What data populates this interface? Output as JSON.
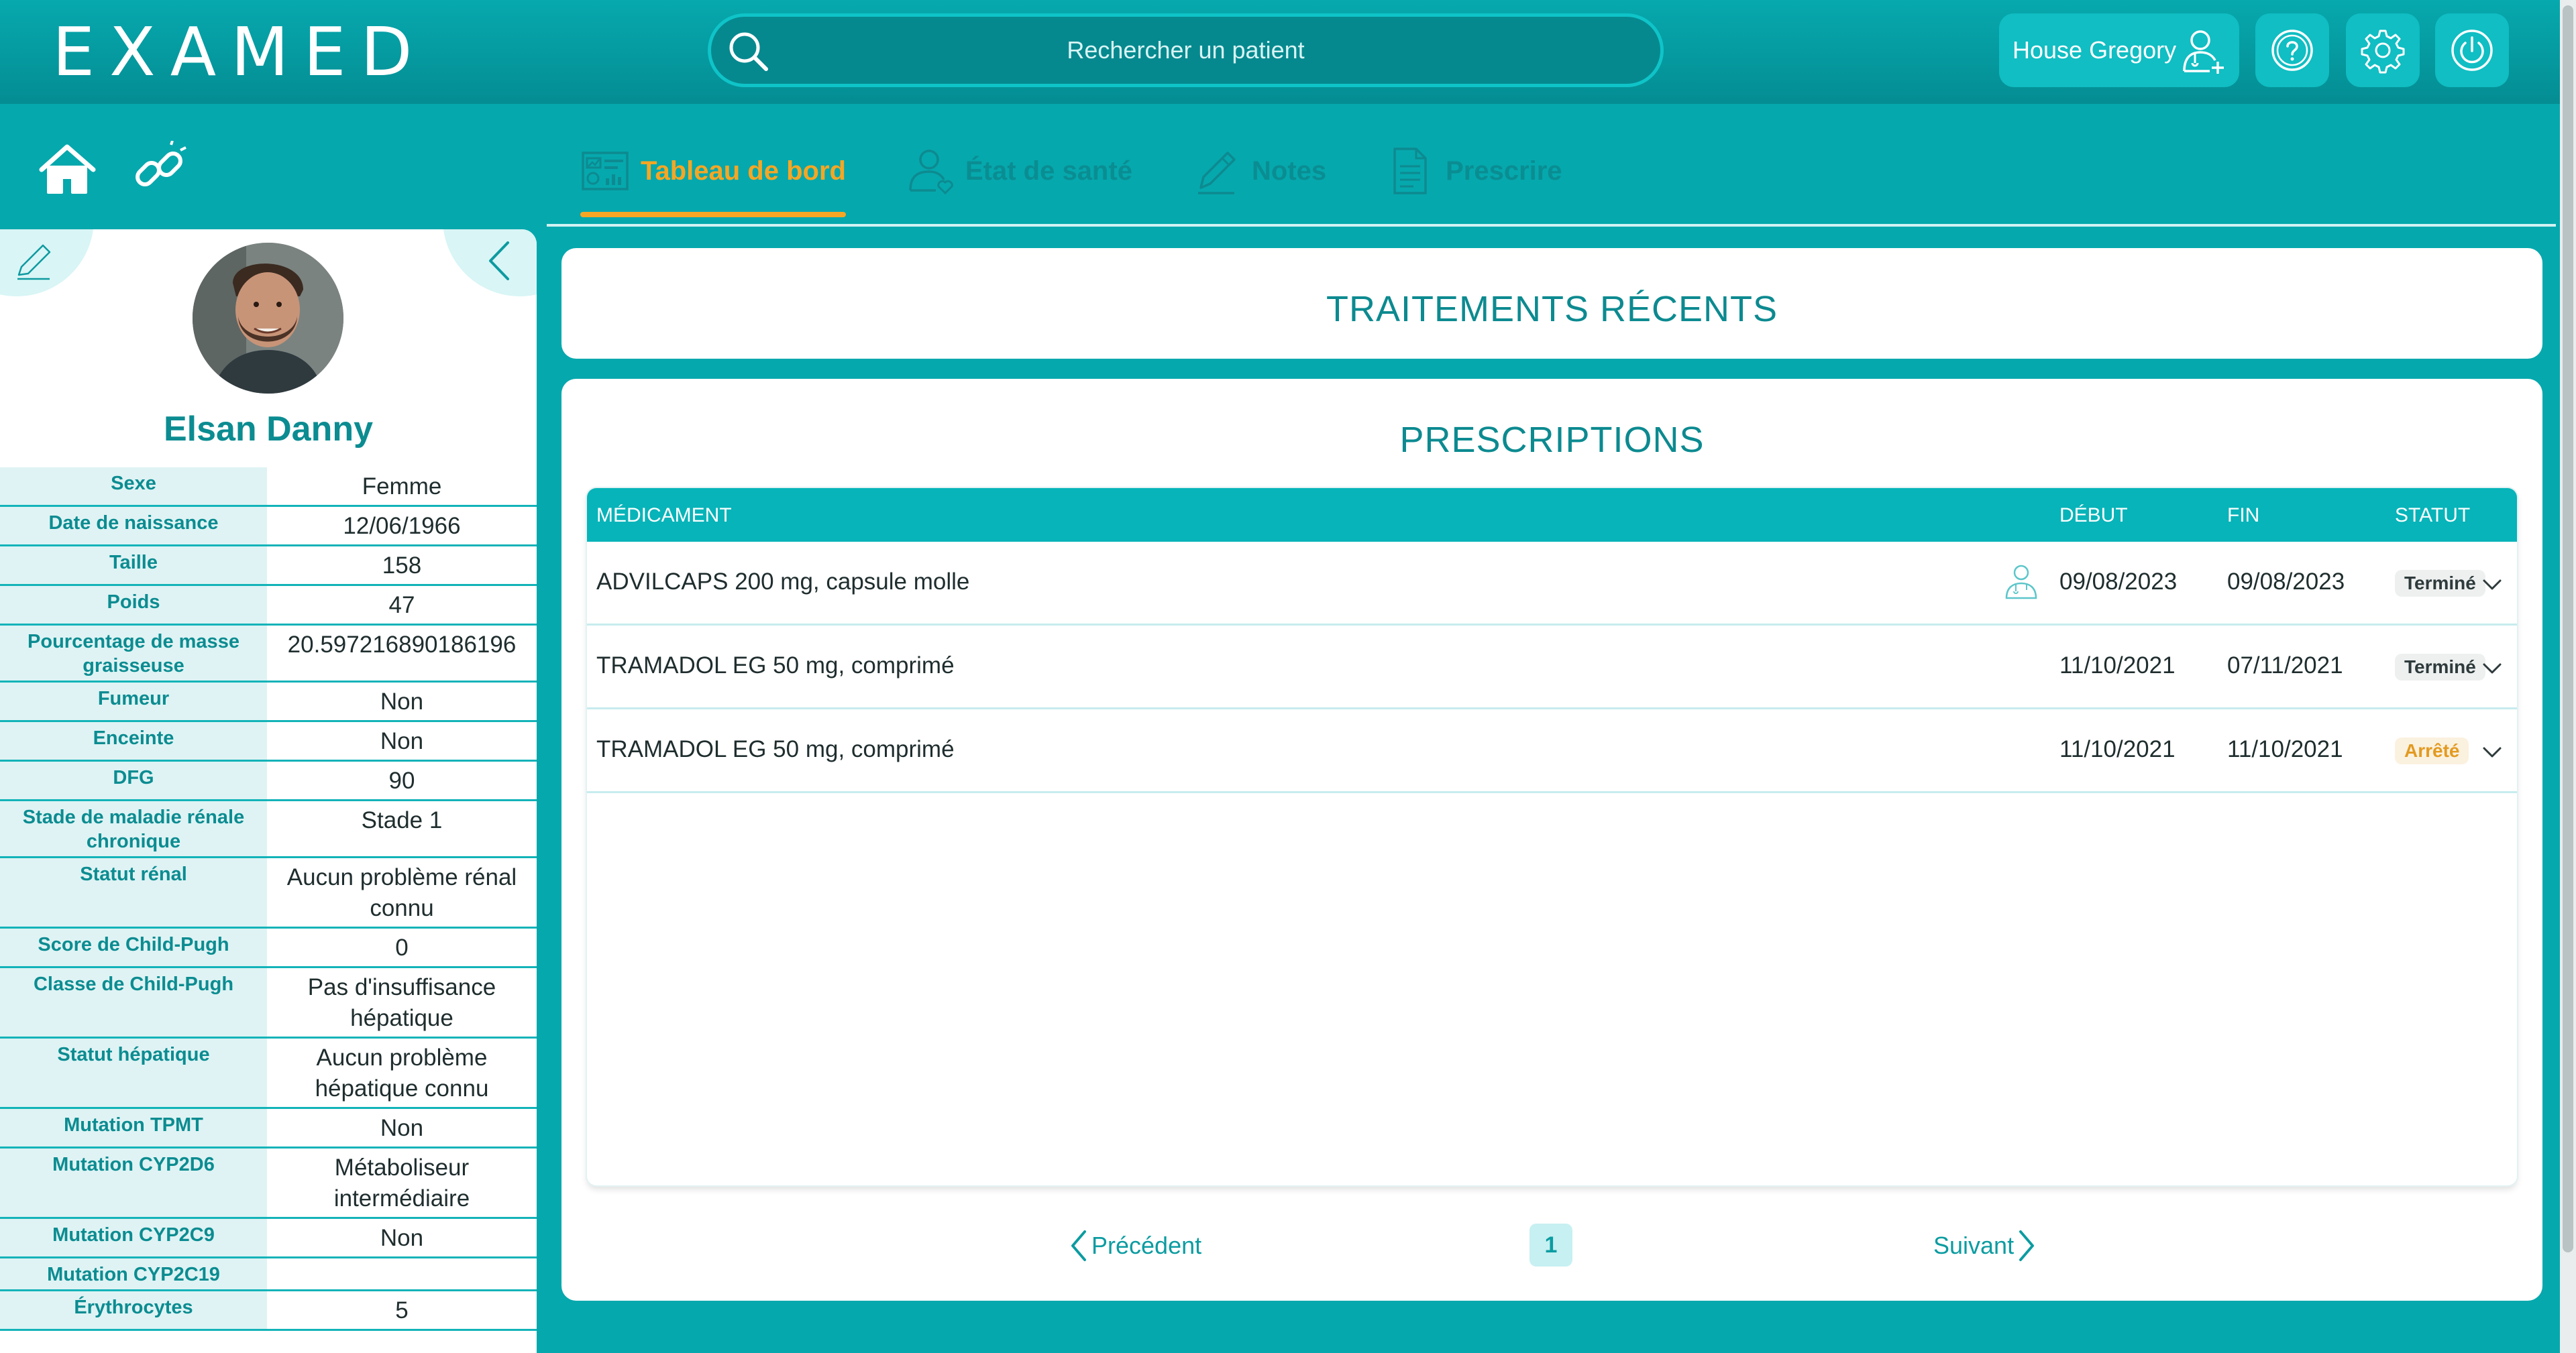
{
  "header": {
    "logo_text": "EXAMED",
    "search_placeholder": "Rechercher un patient",
    "user_name": "House Gregory",
    "icons": [
      "search-icon",
      "doctor-add-icon",
      "help-icon",
      "gear-icon",
      "power-icon"
    ]
  },
  "nav": {
    "icons": [
      "home-icon",
      "link-icon"
    ],
    "tabs": [
      {
        "label": "Tableau de bord",
        "icon": "dashboard-icon",
        "active": true
      },
      {
        "label": "État de santé",
        "icon": "health-icon",
        "active": false
      },
      {
        "label": "Notes",
        "icon": "pencil-icon",
        "active": false
      },
      {
        "label": "Prescrire",
        "icon": "document-icon",
        "active": false
      }
    ],
    "active_color": "#f6a623"
  },
  "patient": {
    "name": "Elsan Danny",
    "fields": [
      {
        "label": "Sexe",
        "value": "Femme"
      },
      {
        "label": "Date de naissance",
        "value": "12/06/1966"
      },
      {
        "label": "Taille",
        "value": "158"
      },
      {
        "label": "Poids",
        "value": "47"
      },
      {
        "label": "Pourcentage de masse graisseuse",
        "value": "20.597216890186196"
      },
      {
        "label": "Fumeur",
        "value": "Non"
      },
      {
        "label": "Enceinte",
        "value": "Non"
      },
      {
        "label": "DFG",
        "value": "90"
      },
      {
        "label": "Stade de maladie rénale chronique",
        "value": "Stade 1"
      },
      {
        "label": "Statut rénal",
        "value": "Aucun problème rénal connu"
      },
      {
        "label": "Score de Child-Pugh",
        "value": "0"
      },
      {
        "label": "Classe de Child-Pugh",
        "value": "Pas d'insuffisance hépatique"
      },
      {
        "label": "Statut hépatique",
        "value": "Aucun problème hépatique connu"
      },
      {
        "label": "Mutation TPMT",
        "value": "Non"
      },
      {
        "label": "Mutation CYP2D6",
        "value": "Métaboliseur intermédiaire"
      },
      {
        "label": "Mutation CYP2C9",
        "value": "Non"
      },
      {
        "label": "Mutation CYP2C19",
        "value": ""
      },
      {
        "label": "Érythrocytes",
        "value": "5"
      }
    ]
  },
  "recent": {
    "title": "TRAITEMENTS RÉCENTS"
  },
  "prescriptions": {
    "title": "PRESCRIPTIONS",
    "columns": {
      "medicament": "MÉDICAMENT",
      "debut": "DÉBUT",
      "fin": "FIN",
      "statut": "STATUT"
    },
    "rows": [
      {
        "medicament": "ADVILCAPS 200 mg, capsule molle",
        "debut": "09/08/2023",
        "fin": "09/08/2023",
        "statut": "Terminé",
        "doctor_icon": true
      },
      {
        "medicament": "TRAMADOL EG 50 mg, comprimé",
        "debut": "11/10/2021",
        "fin": "07/11/2021",
        "statut": "Terminé",
        "doctor_icon": false
      },
      {
        "medicament": "TRAMADOL EG 50 mg, comprimé",
        "debut": "11/10/2021",
        "fin": "11/10/2021",
        "statut": "Arrêté",
        "doctor_icon": false
      }
    ],
    "pager": {
      "prev": "Précédent",
      "page": "1",
      "next": "Suivant"
    }
  }
}
